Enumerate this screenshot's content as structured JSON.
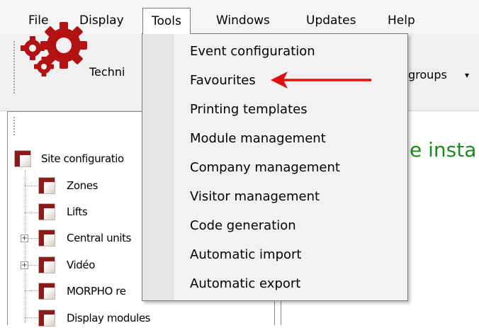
{
  "menubar": {
    "items": [
      "File",
      "Display",
      "Tools",
      "Windows",
      "Updates",
      "Help"
    ],
    "open_item": "Tools"
  },
  "toolbar": {
    "technician_label": "Techni",
    "groups_label": "groups",
    "groups_arrow": "▾"
  },
  "tree": {
    "items": [
      {
        "label": "Site configuratio"
      },
      {
        "label": "Zones"
      },
      {
        "label": "Lifts"
      },
      {
        "label": "Central units"
      },
      {
        "label": "Vidéo"
      },
      {
        "label": "MORPHO re"
      },
      {
        "label": "Display modules"
      }
    ],
    "expander_symbol": "+"
  },
  "main": {
    "welcome_text": "e insta"
  },
  "tools_menu": {
    "items": [
      "Event configuration",
      "Favourites",
      "Printing templates",
      "Module management",
      "Company management",
      "Visitor management",
      "Code generation",
      "Automatic import",
      "Automatic export"
    ],
    "highlighted_item": "Favourites"
  },
  "colors": {
    "arrow": "#e01010",
    "welcome": "#1d8a1d",
    "gear": "#b21212",
    "node_icon": "#8b1a1a"
  },
  "icons": {
    "logo": "gears-icon",
    "pointer": "red-arrow-icon"
  }
}
